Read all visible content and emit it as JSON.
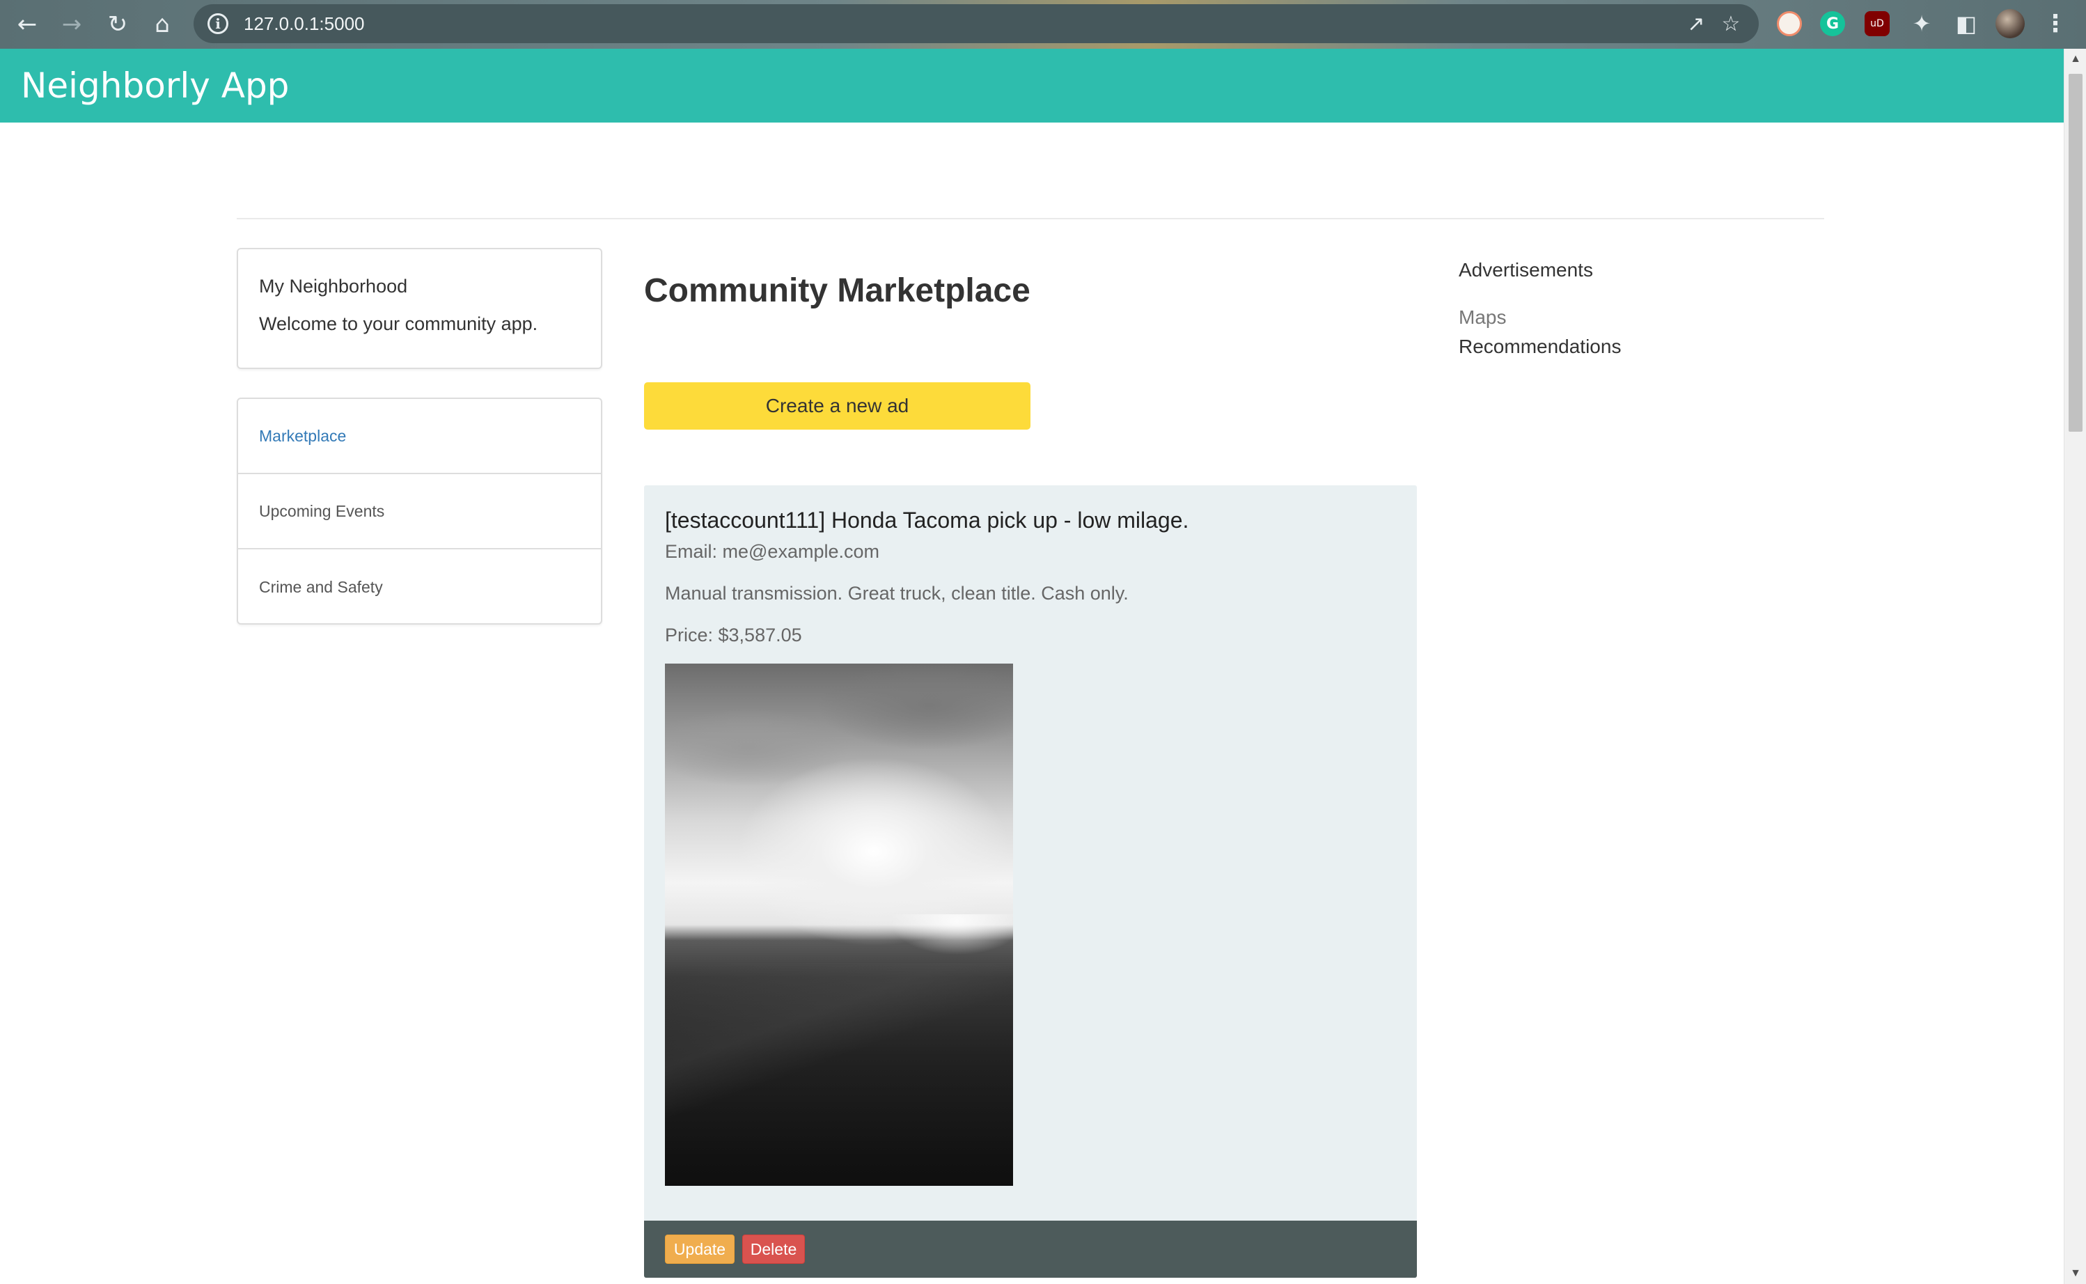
{
  "browser": {
    "url": "127.0.0.1:5000",
    "back_icon": "arrow-left-icon",
    "forward_icon": "arrow-right-icon",
    "reload_icon": "reload-icon",
    "home_icon": "home-icon",
    "extensions": [
      "share-icon",
      "star-icon",
      "extension-icon",
      "grammarly-icon",
      "ublock-icon",
      "puzzle-icon",
      "sidepanel-icon",
      "avatar",
      "kebab-menu-icon"
    ],
    "ext_labels": {
      "grammarly": "G",
      "ublock": "uD"
    }
  },
  "app": {
    "brand": "Neighborly App",
    "navbar_color": "#2ebdad"
  },
  "sidebar": {
    "card_title": "My Neighborhood",
    "card_subtitle": "Welcome to your community app.",
    "nav_items": [
      {
        "label": "Marketplace",
        "active": true
      },
      {
        "label": "Upcoming Events",
        "active": false
      },
      {
        "label": "Crime and Safety",
        "active": false
      }
    ]
  },
  "main": {
    "title": "Community Marketplace",
    "create_button": "Create a new ad",
    "ads": [
      {
        "title": "[testaccount111] Honda Tacoma pick up - low milage.",
        "email": "Email: me@example.com",
        "description": "Manual transmission. Great truck, clean title. Cash only.",
        "price": "Price: $3,587.05",
        "image_alt": "black-and-white landscape photo",
        "update_label": "Update",
        "delete_label": "Delete"
      }
    ]
  },
  "right": {
    "heading": "Advertisements",
    "links": [
      "Maps",
      "Recommendations"
    ]
  },
  "colors": {
    "create_button": "#fddb3a",
    "ad_card_bg": "#e9f0f2",
    "ad_footer_bg": "#4d5b5b",
    "update_button": "#f0ad4e",
    "delete_button": "#d9534f",
    "active_link": "#337ab7"
  }
}
